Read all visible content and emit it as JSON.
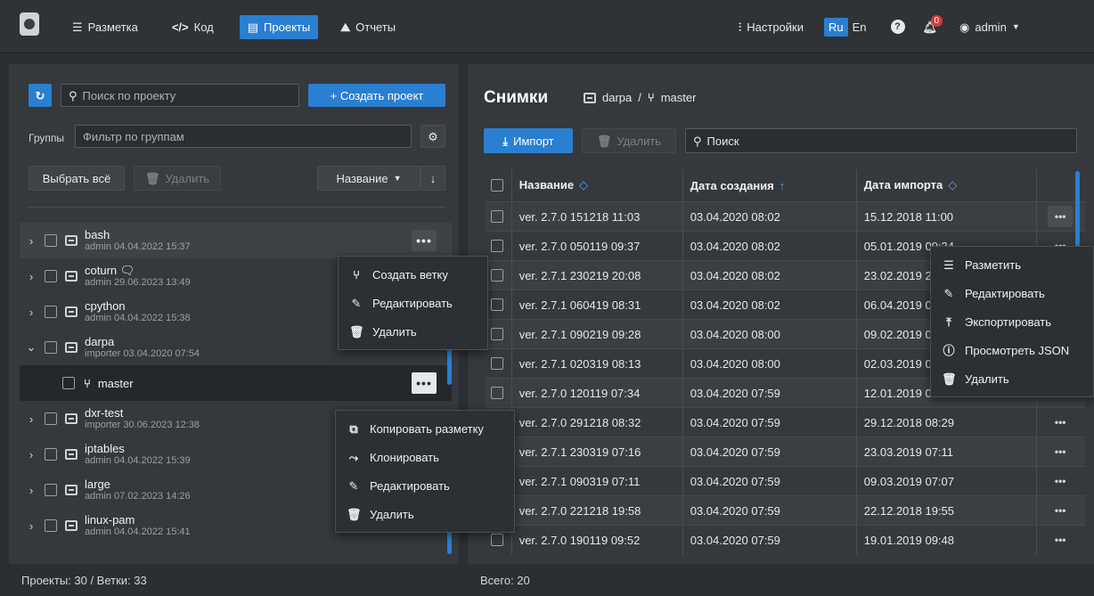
{
  "topbar": {
    "nav": [
      {
        "label": "Разметка",
        "icon": "markup-icon"
      },
      {
        "label": "Код",
        "icon": "code-icon"
      },
      {
        "label": "Проекты",
        "icon": "projects-icon",
        "active": true
      },
      {
        "label": "Отчеты",
        "icon": "reports-icon"
      }
    ],
    "settings": "Настройки",
    "lang": [
      "Ru",
      "En"
    ],
    "notif_count": "0",
    "user": "admin"
  },
  "left": {
    "search_placeholder": "Поиск по проекту",
    "create_label": "+ Создать проект",
    "groups_label": "Группы",
    "groups_placeholder": "Фильтр по группам",
    "select_all": "Выбрать всё",
    "delete": "Удалить",
    "sort_label": "Название",
    "projects": [
      {
        "name": "bash",
        "sub": "admin 04.04.2022 15:37"
      },
      {
        "name": "coturn",
        "sub": "admin 29.06.2023 13:49"
      },
      {
        "name": "cpython",
        "sub": "admin 04.04.2022 15:38"
      },
      {
        "name": "darpa",
        "sub": "importer 03.04.2020 07:54"
      },
      {
        "name": "master",
        "sub": ""
      },
      {
        "name": "dxr-test",
        "sub": "importer 30.06.2023 12:38"
      },
      {
        "name": "iptables",
        "sub": "admin 04.04.2022 15:39"
      },
      {
        "name": "large",
        "sub": "admin 07.02.2023 14:26"
      },
      {
        "name": "linux-pam",
        "sub": "admin 04.04.2022 15:41"
      }
    ],
    "menu1": [
      "Создать ветку",
      "Редактировать",
      "Удалить"
    ],
    "menu2": [
      "Копировать разметку",
      "Клонировать",
      "Редактировать",
      "Удалить"
    ],
    "footer": "Проекты: 30  /  Ветки: 33"
  },
  "right": {
    "title": "Снимки",
    "crumb_project": "darpa",
    "crumb_sep": "/",
    "crumb_branch": "master",
    "import": "Импорт",
    "delete": "Удалить",
    "search_placeholder": "Поиск",
    "columns": [
      "Название",
      "Дата создания",
      "Дата импорта"
    ],
    "rows": [
      [
        "ver. 2.7.0 151218 11:03",
        "03.04.2020 08:02",
        "15.12.2018 11:00"
      ],
      [
        "ver. 2.7.0 050119 09:37",
        "03.04.2020 08:02",
        "05.01.2019 09:34"
      ],
      [
        "ver. 2.7.1 230219 20:08",
        "03.04.2020 08:02",
        "23.02.2019 20:05"
      ],
      [
        "ver. 2.7.1 060419 08:31",
        "03.04.2020 08:02",
        "06.04.2019 08:28"
      ],
      [
        "ver. 2.7.1 090219 09:28",
        "03.04.2020 08:00",
        "09.02.2019 09:25"
      ],
      [
        "ver. 2.7.1 020319 08:13",
        "03.04.2020 08:00",
        "02.03.2019 08:10"
      ],
      [
        "ver. 2.7.0 120119 07:34",
        "03.04.2020 07:59",
        "12.01.2019 07:31"
      ],
      [
        "ver. 2.7.0 291218 08:32",
        "03.04.2020 07:59",
        "29.12.2018 08:29"
      ],
      [
        "ver. 2.7.1 230319 07:16",
        "03.04.2020 07:59",
        "23.03.2019 07:11"
      ],
      [
        "ver. 2.7.1 090319 07:11",
        "03.04.2020 07:59",
        "09.03.2019 07:07"
      ],
      [
        "ver. 2.7.0 221218 19:58",
        "03.04.2020 07:59",
        "22.12.2018 19:55"
      ],
      [
        "ver. 2.7.0 190119 09:52",
        "03.04.2020 07:59",
        "19.01.2019 09:48"
      ]
    ],
    "menu": [
      "Разметить",
      "Редактировать",
      "Экспортировать",
      "Просмотреть JSON",
      "Удалить"
    ],
    "footer": "Всего: 20"
  },
  "colors": {
    "accent": "#2a7fd0",
    "panel": "#35383c",
    "bg": "#2b2e33"
  }
}
